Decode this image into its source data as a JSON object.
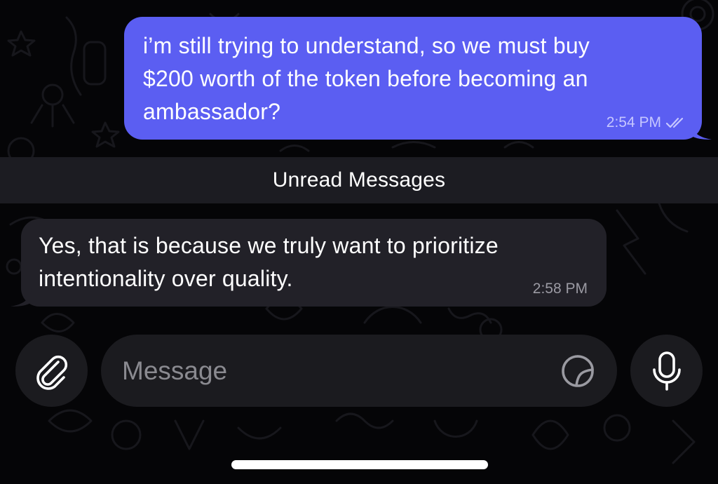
{
  "chat": {
    "outgoing": {
      "text": "i’m still trying to understand, so we must buy\n$200 worth of the token before becoming an\nambassador?",
      "time": "2:54 PM",
      "status_icon": "double-check-icon",
      "color": "#5b5ef2"
    },
    "divider": {
      "label": "Unread Messages"
    },
    "incoming": {
      "text": "Yes, that is because we truly want to prioritize\nintentionality over quality.",
      "time": "2:58 PM",
      "color": "#222128"
    }
  },
  "composer": {
    "placeholder": "Message",
    "attach_icon": "paperclip-icon",
    "sticker_icon": "sticker-icon",
    "mic_icon": "microphone-icon"
  },
  "colors": {
    "background": "#050507",
    "divider_bg": "#1c1c22",
    "control_bg": "#1b1b1f"
  }
}
